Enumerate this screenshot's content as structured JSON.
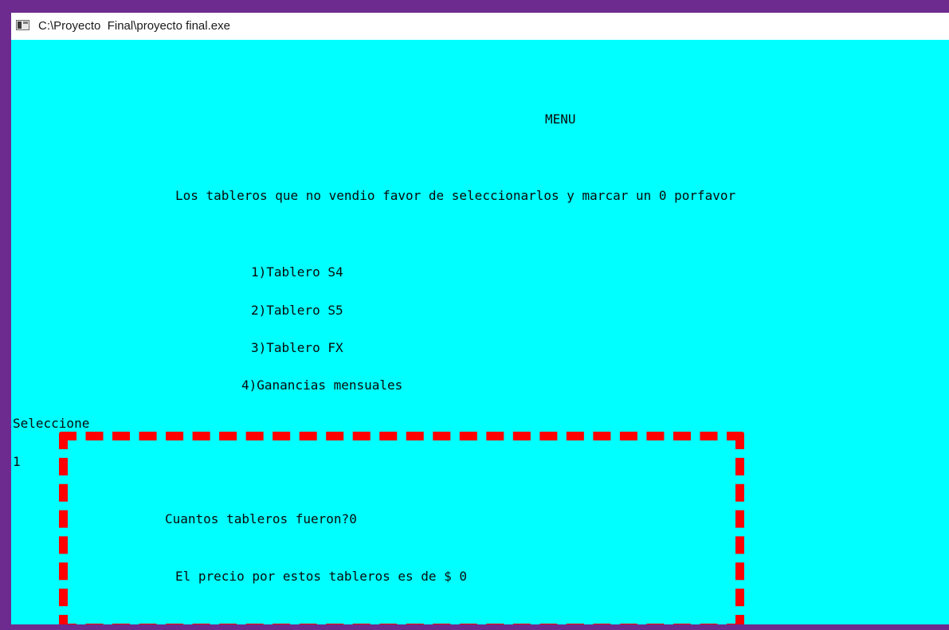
{
  "window": {
    "title": "C:\\Proyecto  Final\\proyecto final.exe"
  },
  "console": {
    "menu_heading": "MENU",
    "instruction": "Los tableros que no vendio favor de seleccionarlos y marcar un 0 porfavor",
    "options": [
      "1)Tablero S4",
      "2)Tablero S5",
      "3)Tablero FX",
      "4)Ganancias mensuales"
    ],
    "select_prompt": "Seleccione",
    "selected_value": "1",
    "quantity_prompt": "Cuantos tableros fueron?0",
    "price_result": "El precio por estos tableros es de $ 0"
  },
  "colors": {
    "console_background": "#00ffff",
    "highlight_border": "#ff0000",
    "outer_frame": "#6e2b8f"
  },
  "icons": {
    "window_icon": "console-window-icon"
  }
}
